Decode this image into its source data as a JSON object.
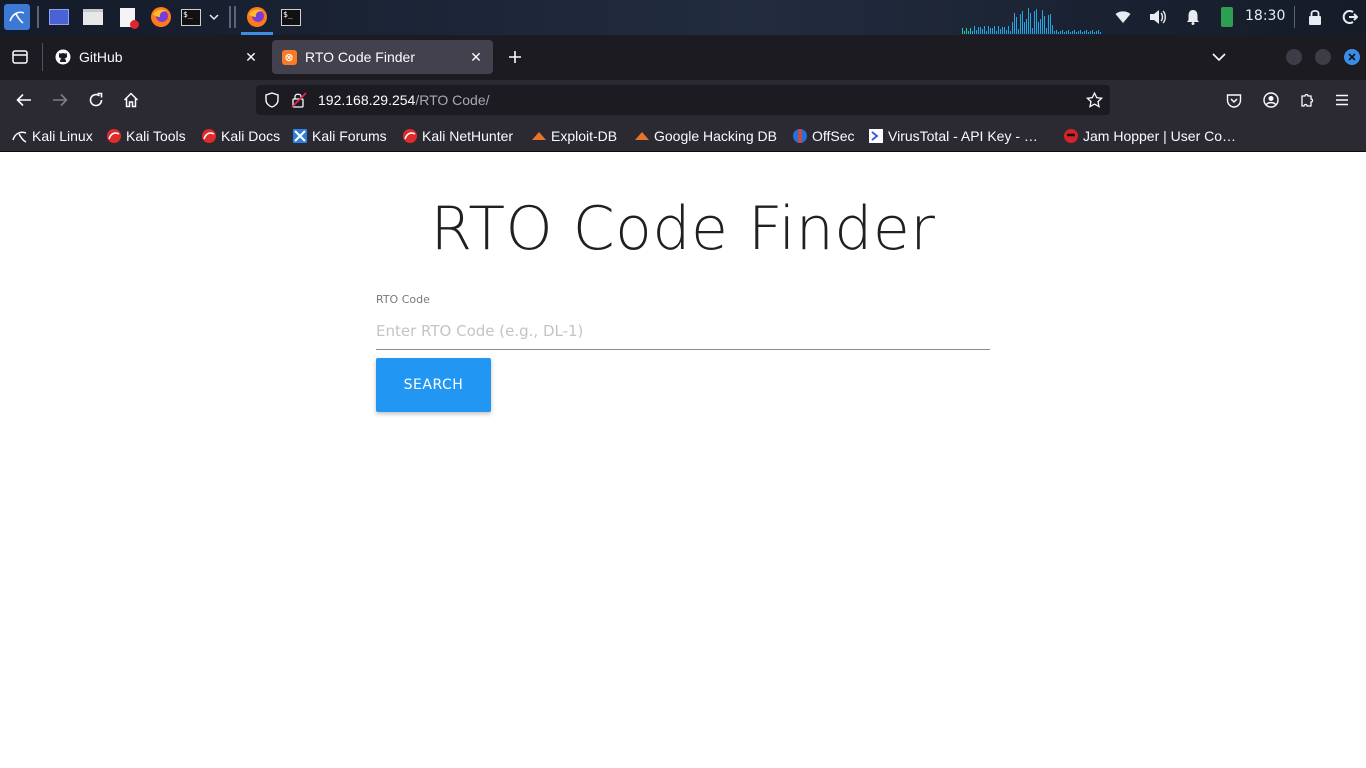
{
  "taskbar": {
    "clock": "18:30",
    "apps": [
      "kali-menu-icon",
      "workspace-icon",
      "file-manager-icon",
      "text-editor-icon",
      "firefox-icon",
      "terminal-icon"
    ]
  },
  "browser": {
    "tabs": [
      {
        "label": "GitHub",
        "active": false
      },
      {
        "label": "RTO Code Finder",
        "active": true
      }
    ],
    "url": {
      "host": "192.168.29.254",
      "path": "/RTO Code/"
    },
    "bookmarks": [
      {
        "label": "Kali Linux",
        "icon": "kali-dragon-icon"
      },
      {
        "label": "Kali Tools",
        "icon": "kali-tools-icon"
      },
      {
        "label": "Kali Docs",
        "icon": "kali-docs-icon"
      },
      {
        "label": "Kali Forums",
        "icon": "kali-forums-icon"
      },
      {
        "label": "Kali NetHunter",
        "icon": "kali-nethunter-icon"
      },
      {
        "label": "Exploit-DB",
        "icon": "exploit-db-icon"
      },
      {
        "label": "Google Hacking DB",
        "icon": "ghdb-icon"
      },
      {
        "label": "OffSec",
        "icon": "offsec-icon"
      },
      {
        "label": "VirusTotal - API Key - …",
        "icon": "virustotal-icon"
      },
      {
        "label": "Jam Hopper | User Co…",
        "icon": "jam-hopper-icon"
      }
    ]
  },
  "page": {
    "title": "RTO Code Finder",
    "field_label": "RTO Code",
    "field_placeholder": "Enter RTO Code (e.g., DL-1)",
    "field_value": "",
    "search_label": "SEARCH"
  },
  "colors": {
    "accent": "#2196f3",
    "tab_active": "#42414d",
    "toolbar": "#2b2a33"
  }
}
